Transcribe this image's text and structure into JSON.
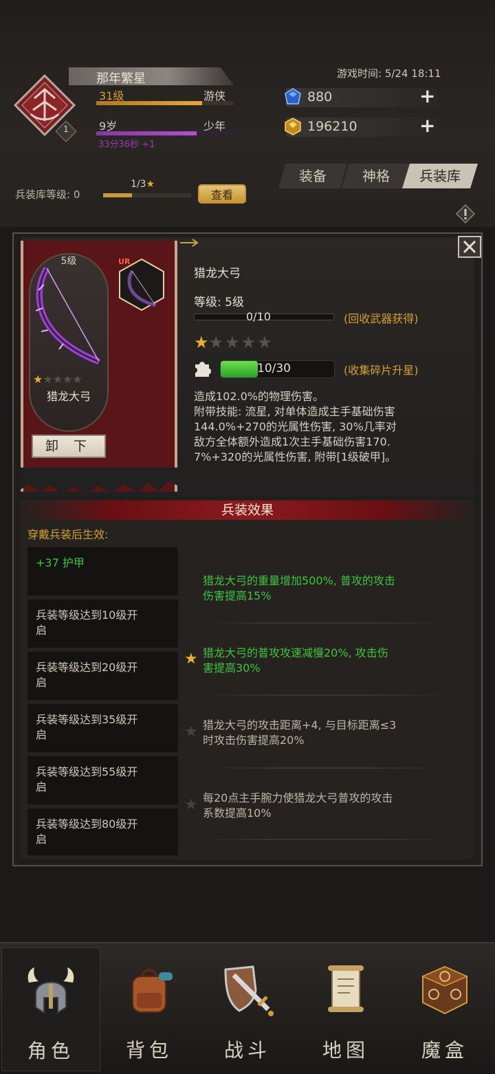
{
  "player": {
    "name": "那年繁星",
    "level_text": "31级",
    "class_text": "游侠",
    "age_text": "9岁",
    "stage_text": "少年",
    "timer_text": "33分36秒 +1",
    "emblem_badge": "1"
  },
  "game_time": "游戏时间: 5/24 18:11",
  "currency": {
    "gem_value": "880",
    "gold_value": "196210"
  },
  "tabs": [
    {
      "label": "装备"
    },
    {
      "label": "神格"
    },
    {
      "label": "兵装库"
    }
  ],
  "armory": {
    "level_label": "兵装库等级: 0",
    "progress_text": "1/3",
    "view_button": "查看"
  },
  "weapon": {
    "level_badge": "5级",
    "rarity": "UR",
    "card_name": "猎龙大弓",
    "unequip_label": "卸 下",
    "title": "猎龙大弓",
    "level_line": "等级: 5级",
    "level_progress_text": "0/10",
    "recycle_hint": "(回收武器获得)",
    "stars": 1,
    "max_stars": 5,
    "shard_progress_text": "10/30",
    "shard_hint": "(收集碎片升星)",
    "desc_lines": [
      "造成102.0%的物理伤害。",
      "附带技能: 流星, 对单体造成主手基础伤害",
      "144.0%+270的光属性伤害, 30%几率对",
      "敌方全体额外造成1次主手基础伤害170.",
      "7%+320的光属性伤害, 附带[1级破甲]。"
    ]
  },
  "effects": {
    "header": "兵装效果",
    "subheader": "穿戴兵装后生效:",
    "rows": [
      {
        "condition": "+37 护甲",
        "effect_lines": [
          "猎龙大弓的重量增加500%, 普攻的攻击",
          "伤害提高15%"
        ]
      },
      {
        "condition_lines": [
          "兵装等级达到10级开",
          "启"
        ],
        "effect_lines": [
          "猎龙大弓的普攻攻速减慢20%, 攻击伤",
          "害提高30%"
        ]
      },
      {
        "condition_lines": [
          "兵装等级达到20级开",
          "启"
        ],
        "effect_lines": [
          "猎龙大弓的攻击距离+4, 与目标距离≤3",
          "时攻击伤害提高20%"
        ]
      },
      {
        "condition_lines": [
          "兵装等级达到35级开",
          "启"
        ],
        "effect_lines": [
          "每20点主手腕力使猎龙大弓普攻的攻击",
          "系数提高10%"
        ]
      },
      {
        "condition_lines": [
          "兵装等级达到55级开",
          "启"
        ]
      },
      {
        "condition_lines": [
          "兵装等级达到80级开",
          "启"
        ]
      }
    ]
  },
  "nav": [
    {
      "label": "角色",
      "icon": "helmet-icon"
    },
    {
      "label": "背包",
      "icon": "backpack-icon"
    },
    {
      "label": "战斗",
      "icon": "sword-shield-icon"
    },
    {
      "label": "地图",
      "icon": "scroll-map-icon"
    },
    {
      "label": "魔盒",
      "icon": "magic-box-icon"
    }
  ],
  "colors": {
    "gold_accent": "#d4a035",
    "green_effect": "#3ec63e",
    "banner_red": "#5a1519",
    "purple_bar": "#b24fd0"
  }
}
